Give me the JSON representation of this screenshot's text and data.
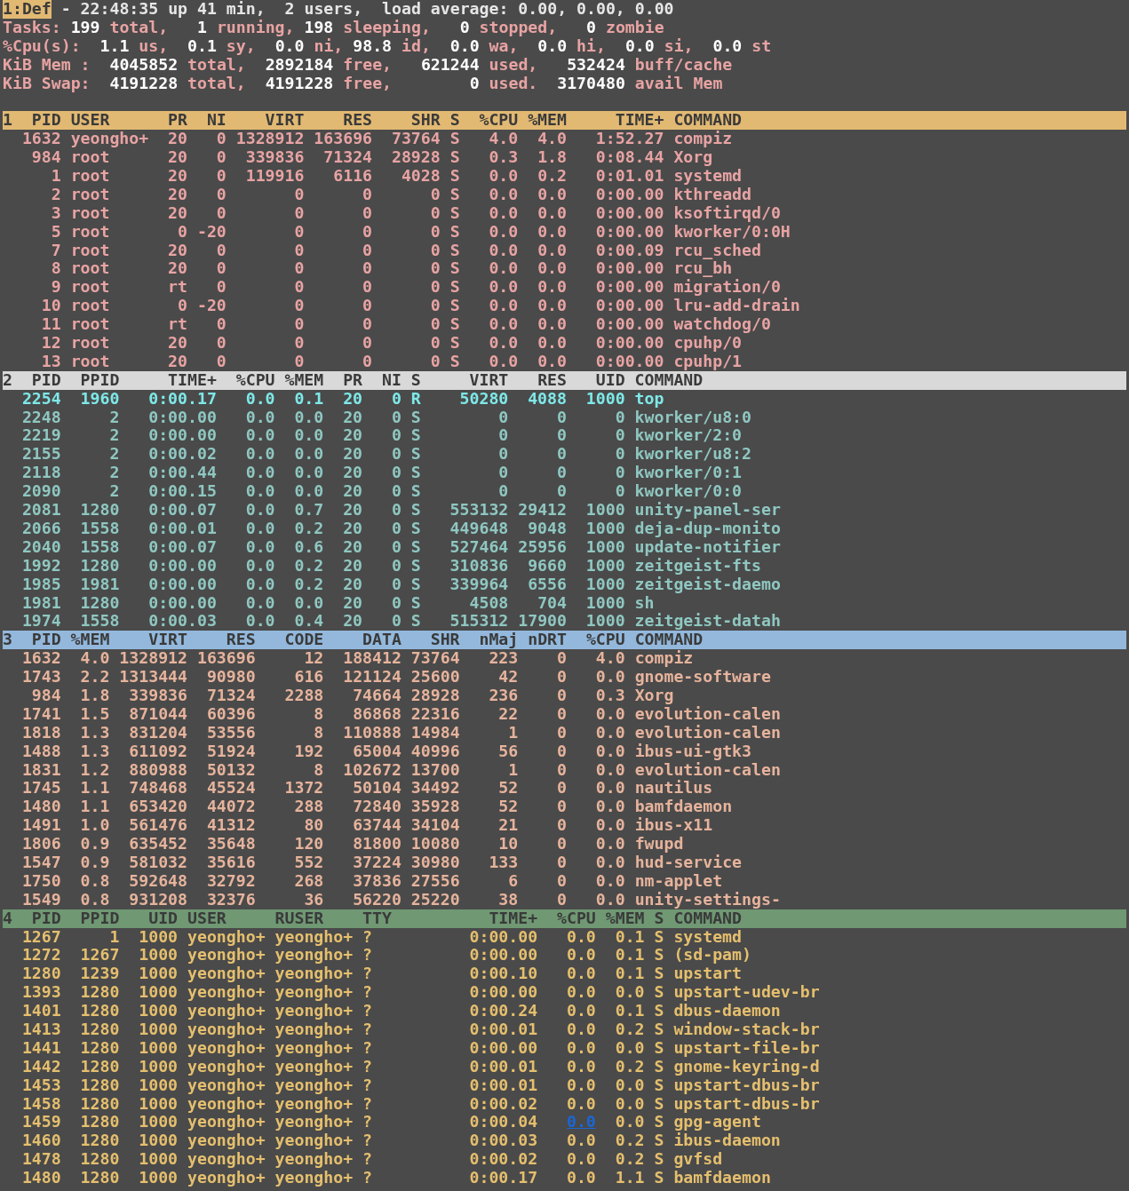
{
  "summary": {
    "window_label": "1:Def",
    "uptime": "- 22:48:35 up 41 min,  2 users,  load average: 0.00, 0.00, 0.00",
    "lines": [
      "Tasks: **199** total,   **1** running, **198** sleeping,   **0** stopped,   **0** zombie",
      "%Cpu(s):  **1.1** us,  **0.1** sy,  **0.0** ni, **98.8** id,  **0.0** wa,  **0.0** hi,  **0.0** si,  **0.0** st",
      "KiB Mem :  **4045852** total,  **2892184** free,   **621244** used,   **532424** buff/cache",
      "KiB Swap:  **4191228** total,  **4191228** free,        **0** used.  **3170480** avail Mem"
    ]
  },
  "sections": [
    {
      "number": "1",
      "color": "#e2b973",
      "columns": [
        "PID",
        "USER",
        "PR",
        "NI",
        "VIRT",
        "RES",
        "SHR",
        "S",
        "%CPU",
        "%MEM",
        "TIME+",
        "COMMAND"
      ],
      "rows": [
        {
          "cells": [
            "1632",
            "yeongho+",
            "20",
            "0",
            "1328912",
            "163696",
            "73764",
            "S",
            "4.0",
            "4.0",
            "1:52.27",
            "compiz"
          ]
        },
        {
          "cells": [
            "984",
            "root",
            "20",
            "0",
            "339836",
            "71324",
            "28928",
            "S",
            "0.3",
            "1.8",
            "0:08.44",
            "Xorg"
          ]
        },
        {
          "cells": [
            "1",
            "root",
            "20",
            "0",
            "119916",
            "6116",
            "4028",
            "S",
            "0.0",
            "0.2",
            "0:01.01",
            "systemd"
          ]
        },
        {
          "cells": [
            "2",
            "root",
            "20",
            "0",
            "0",
            "0",
            "0",
            "S",
            "0.0",
            "0.0",
            "0:00.00",
            "kthreadd"
          ]
        },
        {
          "cells": [
            "3",
            "root",
            "20",
            "0",
            "0",
            "0",
            "0",
            "S",
            "0.0",
            "0.0",
            "0:00.00",
            "ksoftirqd/0"
          ]
        },
        {
          "cells": [
            "5",
            "root",
            "0",
            "-20",
            "0",
            "0",
            "0",
            "S",
            "0.0",
            "0.0",
            "0:00.00",
            "kworker/0:0H"
          ]
        },
        {
          "cells": [
            "7",
            "root",
            "20",
            "0",
            "0",
            "0",
            "0",
            "S",
            "0.0",
            "0.0",
            "0:00.09",
            "rcu_sched"
          ]
        },
        {
          "cells": [
            "8",
            "root",
            "20",
            "0",
            "0",
            "0",
            "0",
            "S",
            "0.0",
            "0.0",
            "0:00.00",
            "rcu_bh"
          ]
        },
        {
          "cells": [
            "9",
            "root",
            "rt",
            "0",
            "0",
            "0",
            "0",
            "S",
            "0.0",
            "0.0",
            "0:00.00",
            "migration/0"
          ]
        },
        {
          "cells": [
            "10",
            "root",
            "0",
            "-20",
            "0",
            "0",
            "0",
            "S",
            "0.0",
            "0.0",
            "0:00.00",
            "lru-add-drain"
          ]
        },
        {
          "cells": [
            "11",
            "root",
            "rt",
            "0",
            "0",
            "0",
            "0",
            "S",
            "0.0",
            "0.0",
            "0:00.00",
            "watchdog/0"
          ]
        },
        {
          "cells": [
            "12",
            "root",
            "20",
            "0",
            "0",
            "0",
            "0",
            "S",
            "0.0",
            "0.0",
            "0:00.00",
            "cpuhp/0"
          ]
        },
        {
          "cells": [
            "13",
            "root",
            "20",
            "0",
            "0",
            "0",
            "0",
            "S",
            "0.0",
            "0.0",
            "0:00.00",
            "cpuhp/1"
          ]
        }
      ]
    },
    {
      "number": "2",
      "color": "#d9d9d9",
      "columns": [
        "PID",
        "PPID",
        "TIME+",
        "%CPU",
        "%MEM",
        "PR",
        "NI",
        "S",
        "VIRT",
        "RES",
        "UID",
        "COMMAND"
      ],
      "rows": [
        {
          "highlighted": true,
          "cells": [
            "2254",
            "1960",
            "0:00.17",
            "0.0",
            "0.1",
            "20",
            "0",
            "R",
            "50280",
            "4088",
            "1000",
            "top"
          ]
        },
        {
          "highlighted": false,
          "cells": [
            "2248",
            "2",
            "0:00.00",
            "0.0",
            "0.0",
            "20",
            "0",
            "S",
            "0",
            "0",
            "0",
            "kworker/u8:0"
          ]
        },
        {
          "highlighted": false,
          "cells": [
            "2219",
            "2",
            "0:00.00",
            "0.0",
            "0.0",
            "20",
            "0",
            "S",
            "0",
            "0",
            "0",
            "kworker/2:0"
          ]
        },
        {
          "highlighted": false,
          "cells": [
            "2155",
            "2",
            "0:00.02",
            "0.0",
            "0.0",
            "20",
            "0",
            "S",
            "0",
            "0",
            "0",
            "kworker/u8:2"
          ]
        },
        {
          "highlighted": false,
          "cells": [
            "2118",
            "2",
            "0:00.44",
            "0.0",
            "0.0",
            "20",
            "0",
            "S",
            "0",
            "0",
            "0",
            "kworker/0:1"
          ]
        },
        {
          "highlighted": false,
          "cells": [
            "2090",
            "2",
            "0:00.15",
            "0.0",
            "0.0",
            "20",
            "0",
            "S",
            "0",
            "0",
            "0",
            "kworker/0:0"
          ]
        },
        {
          "highlighted": false,
          "cells": [
            "2081",
            "1280",
            "0:00.07",
            "0.0",
            "0.7",
            "20",
            "0",
            "S",
            "553132",
            "29412",
            "1000",
            "unity-panel-ser"
          ]
        },
        {
          "highlighted": false,
          "cells": [
            "2066",
            "1558",
            "0:00.01",
            "0.0",
            "0.2",
            "20",
            "0",
            "S",
            "449648",
            "9048",
            "1000",
            "deja-dup-monito"
          ]
        },
        {
          "highlighted": false,
          "cells": [
            "2040",
            "1558",
            "0:00.07",
            "0.0",
            "0.6",
            "20",
            "0",
            "S",
            "527464",
            "25956",
            "1000",
            "update-notifier"
          ]
        },
        {
          "highlighted": false,
          "cells": [
            "1992",
            "1280",
            "0:00.00",
            "0.0",
            "0.2",
            "20",
            "0",
            "S",
            "310836",
            "9660",
            "1000",
            "zeitgeist-fts"
          ]
        },
        {
          "highlighted": false,
          "cells": [
            "1985",
            "1981",
            "0:00.00",
            "0.0",
            "0.2",
            "20",
            "0",
            "S",
            "339964",
            "6556",
            "1000",
            "zeitgeist-daemo"
          ]
        },
        {
          "highlighted": false,
          "cells": [
            "1981",
            "1280",
            "0:00.00",
            "0.0",
            "0.0",
            "20",
            "0",
            "S",
            "4508",
            "704",
            "1000",
            "sh"
          ]
        },
        {
          "highlighted": false,
          "cells": [
            "1974",
            "1558",
            "0:00.03",
            "0.0",
            "0.4",
            "20",
            "0",
            "S",
            "515312",
            "17900",
            "1000",
            "zeitgeist-datah"
          ]
        }
      ]
    },
    {
      "number": "3",
      "color": "#93b8dc",
      "columns": [
        "PID",
        "%MEM",
        "VIRT",
        "RES",
        "CODE",
        "DATA",
        "SHR",
        "nMaj",
        "nDRT",
        "%CPU",
        "COMMAND"
      ],
      "rows": [
        {
          "cells": [
            "1632",
            "4.0",
            "1328912",
            "163696",
            "12",
            "188412",
            "73764",
            "223",
            "0",
            "4.0",
            "compiz"
          ]
        },
        {
          "cells": [
            "1743",
            "2.2",
            "1313444",
            "90980",
            "616",
            "121124",
            "25600",
            "42",
            "0",
            "0.0",
            "gnome-software"
          ]
        },
        {
          "cells": [
            "984",
            "1.8",
            "339836",
            "71324",
            "2288",
            "74664",
            "28928",
            "236",
            "0",
            "0.3",
            "Xorg"
          ]
        },
        {
          "cells": [
            "1741",
            "1.5",
            "871044",
            "60396",
            "8",
            "86868",
            "22316",
            "22",
            "0",
            "0.0",
            "evolution-calen"
          ]
        },
        {
          "cells": [
            "1818",
            "1.3",
            "831204",
            "53556",
            "8",
            "110888",
            "14984",
            "1",
            "0",
            "0.0",
            "evolution-calen"
          ]
        },
        {
          "cells": [
            "1488",
            "1.3",
            "611092",
            "51924",
            "192",
            "65004",
            "40996",
            "56",
            "0",
            "0.0",
            "ibus-ui-gtk3"
          ]
        },
        {
          "cells": [
            "1831",
            "1.2",
            "880988",
            "50132",
            "8",
            "102672",
            "13700",
            "1",
            "0",
            "0.0",
            "evolution-calen"
          ]
        },
        {
          "cells": [
            "1745",
            "1.1",
            "748468",
            "45524",
            "1372",
            "50104",
            "34492",
            "52",
            "0",
            "0.0",
            "nautilus"
          ]
        },
        {
          "cells": [
            "1480",
            "1.1",
            "653420",
            "44072",
            "288",
            "72840",
            "35928",
            "52",
            "0",
            "0.0",
            "bamfdaemon"
          ]
        },
        {
          "cells": [
            "1491",
            "1.0",
            "561476",
            "41312",
            "80",
            "63744",
            "34104",
            "21",
            "0",
            "0.0",
            "ibus-x11"
          ]
        },
        {
          "cells": [
            "1806",
            "0.9",
            "635452",
            "35648",
            "120",
            "81800",
            "10080",
            "10",
            "0",
            "0.0",
            "fwupd"
          ]
        },
        {
          "cells": [
            "1547",
            "0.9",
            "581032",
            "35616",
            "552",
            "37224",
            "30980",
            "133",
            "0",
            "0.0",
            "hud-service"
          ]
        },
        {
          "cells": [
            "1750",
            "0.8",
            "592648",
            "32792",
            "268",
            "37836",
            "27556",
            "6",
            "0",
            "0.0",
            "nm-applet"
          ]
        },
        {
          "cells": [
            "1549",
            "0.8",
            "931208",
            "32376",
            "36",
            "56220",
            "25220",
            "38",
            "0",
            "0.0",
            "unity-settings-"
          ]
        }
      ]
    },
    {
      "number": "4",
      "color": "#6f9873",
      "columns": [
        "PID",
        "PPID",
        "UID",
        "USER",
        "RUSER",
        "TTY",
        "TIME+",
        "%CPU",
        "%MEM",
        "S",
        "COMMAND"
      ],
      "rows": [
        {
          "cells": [
            "1267",
            "1",
            "1000",
            "yeongho+",
            "yeongho+",
            "?",
            "0:00.00",
            "0.0",
            "0.1",
            "S",
            "systemd"
          ]
        },
        {
          "cells": [
            "1272",
            "1267",
            "1000",
            "yeongho+",
            "yeongho+",
            "?",
            "0:00.00",
            "0.0",
            "0.1",
            "S",
            "(sd-pam)"
          ]
        },
        {
          "cells": [
            "1280",
            "1239",
            "1000",
            "yeongho+",
            "yeongho+",
            "?",
            "0:00.10",
            "0.0",
            "0.1",
            "S",
            "upstart"
          ]
        },
        {
          "cells": [
            "1393",
            "1280",
            "1000",
            "yeongho+",
            "yeongho+",
            "?",
            "0:00.00",
            "0.0",
            "0.0",
            "S",
            "upstart-udev-br"
          ]
        },
        {
          "cells": [
            "1401",
            "1280",
            "1000",
            "yeongho+",
            "yeongho+",
            "?",
            "0:00.24",
            "0.0",
            "0.1",
            "S",
            "dbus-daemon"
          ]
        },
        {
          "cells": [
            "1413",
            "1280",
            "1000",
            "yeongho+",
            "yeongho+",
            "?",
            "0:00.01",
            "0.0",
            "0.2",
            "S",
            "window-stack-br"
          ]
        },
        {
          "cells": [
            "1441",
            "1280",
            "1000",
            "yeongho+",
            "yeongho+",
            "?",
            "0:00.00",
            "0.0",
            "0.0",
            "S",
            "upstart-file-br"
          ]
        },
        {
          "cells": [
            "1442",
            "1280",
            "1000",
            "yeongho+",
            "yeongho+",
            "?",
            "0:00.01",
            "0.0",
            "0.2",
            "S",
            "gnome-keyring-d"
          ]
        },
        {
          "cells": [
            "1453",
            "1280",
            "1000",
            "yeongho+",
            "yeongho+",
            "?",
            "0:00.01",
            "0.0",
            "0.0",
            "S",
            "upstart-dbus-br"
          ]
        },
        {
          "cells": [
            "1458",
            "1280",
            "1000",
            "yeongho+",
            "yeongho+",
            "?",
            "0:00.02",
            "0.0",
            "0.0",
            "S",
            "upstart-dbus-br"
          ]
        },
        {
          "cells": [
            "1459",
            "1280",
            "1000",
            "yeongho+",
            "yeongho+",
            "?",
            "0:00.04",
            {
              "kind": "link",
              "text": "0.0"
            },
            "0.0",
            "S",
            "gpg-agent"
          ]
        },
        {
          "cells": [
            "1460",
            "1280",
            "1000",
            "yeongho+",
            "yeongho+",
            "?",
            "0:00.03",
            "0.0",
            "0.2",
            "S",
            "ibus-daemon"
          ]
        },
        {
          "cells": [
            "1478",
            "1280",
            "1000",
            "yeongho+",
            "yeongho+",
            "?",
            "0:00.02",
            "0.0",
            "0.2",
            "S",
            "gvfsd"
          ]
        },
        {
          "cells": [
            "1480",
            "1280",
            "1000",
            "yeongho+",
            "yeongho+",
            "?",
            "0:00.17",
            "0.0",
            "1.1",
            "S",
            "bamfdaemon"
          ]
        }
      ]
    }
  ]
}
